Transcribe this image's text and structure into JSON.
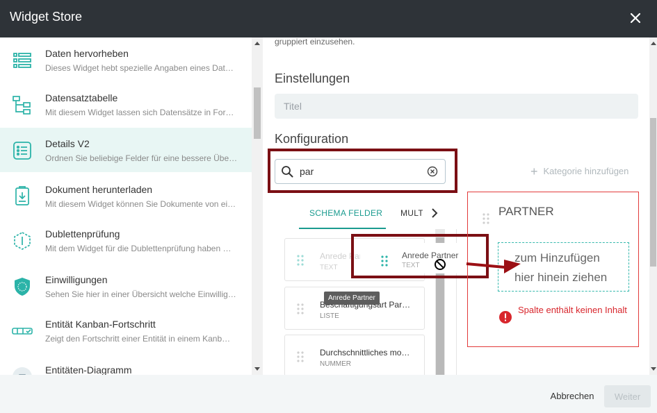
{
  "window": {
    "title": "Widget Store"
  },
  "sidebar": {
    "items": [
      {
        "name": "Daten hervorheben",
        "desc": "Dieses Widget hebt spezielle Angaben eines Dat…",
        "icon": "list-highlight-icon",
        "active": false
      },
      {
        "name": "Datensatztabelle",
        "desc": "Mit diesem Widget lassen sich Datensätze in For…",
        "icon": "tree-table-icon",
        "active": false
      },
      {
        "name": "Details V2",
        "desc": "Ordnen Sie beliebige Felder für eine bessere Übe…",
        "icon": "details-list-icon",
        "active": true
      },
      {
        "name": "Dokument herunterladen",
        "desc": "Mit diesem Widget können Sie Dokumente von ei…",
        "icon": "document-download-icon",
        "active": false
      },
      {
        "name": "Dublettenprüfung",
        "desc": "Mit dem Widget für die Dublettenprüfung haben …",
        "icon": "duplicate-check-icon",
        "active": false
      },
      {
        "name": "Einwilligungen",
        "desc": "Sehen Sie hier in einer Übersicht welche Einwillig…",
        "icon": "gdpr-shield-icon",
        "active": false
      },
      {
        "name": "Entität Kanban-Fortschritt",
        "desc": "Zeigt den Fortschritt einer Entität in einem Kanb…",
        "icon": "kanban-progress-icon",
        "active": false
      },
      {
        "name": "Entitäten-Diagramm",
        "desc": "",
        "icon": "entity-diagram-icon",
        "active": false
      }
    ]
  },
  "main": {
    "cut_text": "gruppiert einzusehen.",
    "settings_heading": "Einstellungen",
    "title_placeholder": "Titel",
    "config_heading": "Konfiguration",
    "search": {
      "value": "par"
    },
    "add_category": "Kategorie hinzufügen",
    "tabs": [
      "SCHEMA FELDER",
      "MULTI"
    ],
    "fields": [
      {
        "name": "Anrede Partner",
        "type": "TEXT"
      },
      {
        "name": "Beschäftigungsart Par…",
        "type": "LISTE"
      },
      {
        "name": "Durchschnittliches mo…",
        "type": "NUMMER"
      }
    ],
    "drag_ghost": {
      "name": "Anrede Partner",
      "type": "TEXT"
    },
    "tooltip": "Anrede Partner",
    "column": {
      "title": "PARTNER",
      "drop_line1": "zum Hinzufügen",
      "drop_line2": "hier hinein ziehen",
      "error": "Spalte enthält keinen Inhalt"
    }
  },
  "footer": {
    "back": "Abbrechen",
    "next": "Weiter"
  },
  "colors": {
    "accent": "#1a9b8f",
    "error": "#d8262c",
    "annotation": "#7b0f14",
    "titlebar": "#2e3338"
  }
}
